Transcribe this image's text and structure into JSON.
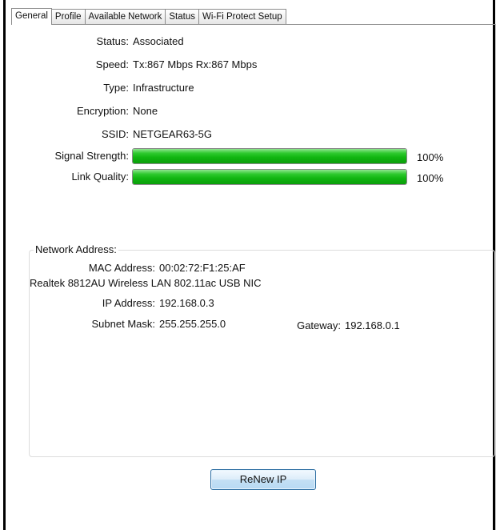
{
  "tabs": [
    "General",
    "Profile",
    "Available Network",
    "Status",
    "Wi-Fi Protect Setup"
  ],
  "active_tab": "General",
  "general": {
    "status_label": "Status:",
    "status_value": "Associated",
    "speed_label": "Speed:",
    "speed_value": "Tx:867 Mbps Rx:867 Mbps",
    "type_label": "Type:",
    "type_value": "Infrastructure",
    "encryption_label": "Encryption:",
    "encryption_value": "None",
    "ssid_label": "SSID:",
    "ssid_value": "NETGEAR63-5G",
    "signal_label": "Signal Strength:",
    "signal_percent_text": "100%",
    "signal_level": 1.0,
    "link_label": "Link Quality:",
    "link_percent_text": "100%",
    "link_level": 1.0,
    "bar_color": "#1ec21e"
  },
  "network_address": {
    "title": "Network Address:",
    "mac_label": "MAC Address:",
    "mac_value": "00:02:72:F1:25:AF",
    "adapter_name": "Realtek 8812AU Wireless LAN 802.11ac USB NIC",
    "ip_label": "IP Address:",
    "ip_value": "192.168.0.3",
    "subnet_label": "Subnet Mask:",
    "subnet_value": "255.255.255.0",
    "gateway_label": "Gateway:",
    "gateway_value": "192.168.0.1"
  },
  "buttons": {
    "renew_ip": "ReNew IP"
  }
}
